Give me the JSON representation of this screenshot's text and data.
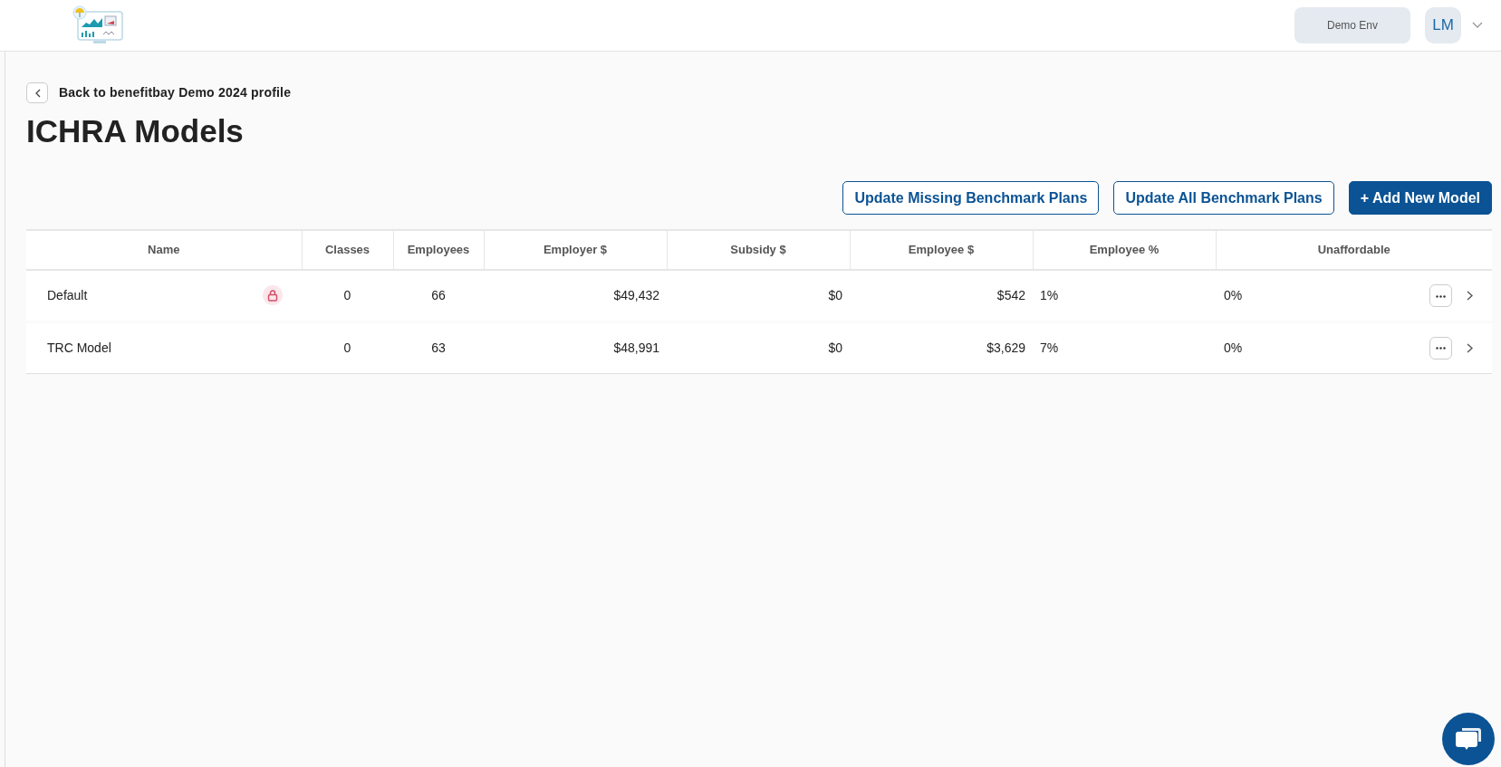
{
  "header": {
    "env_button": "Demo Env",
    "avatar": "LM"
  },
  "back_link": "Back to benefitbay Demo 2024 profile",
  "title": "ICHRA Models",
  "actions": [
    {
      "label": "Update Missing Benchmark Plans",
      "kind": "outline"
    },
    {
      "label": "Update All Benchmark Plans",
      "kind": "outline"
    },
    {
      "label": "+ Add New Model",
      "kind": "primary"
    }
  ],
  "table": {
    "columns": [
      "Name",
      "Classes",
      "Employees",
      "Employer $",
      "Subsidy $",
      "Employee $",
      "Employee %",
      "Unaffordable"
    ],
    "rows": [
      {
        "name": "Default",
        "locked": true,
        "classes": "0",
        "employees": "66",
        "employer": "$49,432",
        "subsidy": "$0",
        "employee": "$542",
        "employee_pct": "1%",
        "unaffordable": "0%"
      },
      {
        "name": "TRC Model",
        "locked": false,
        "classes": "0",
        "employees": "63",
        "employer": "$48,991",
        "subsidy": "$0",
        "employee": "$3,629",
        "employee_pct": "7%",
        "unaffordable": "0%"
      }
    ]
  }
}
